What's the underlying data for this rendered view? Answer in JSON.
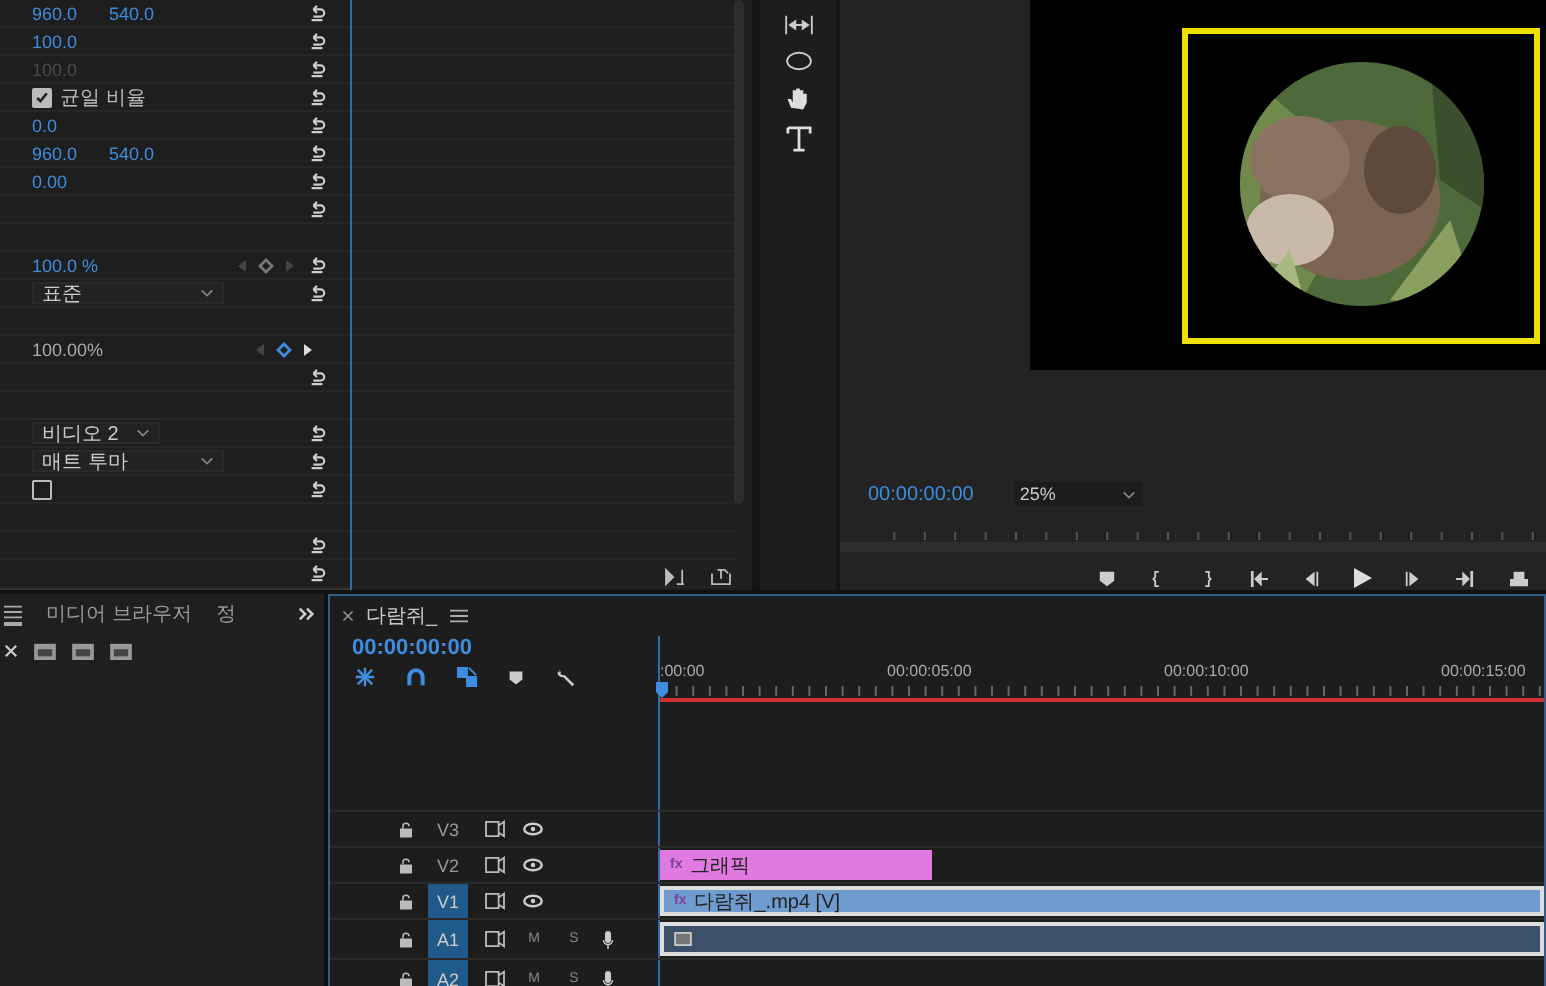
{
  "effect_controls": {
    "rows": [
      {
        "kind": "values",
        "values": [
          "960.0",
          "540.0"
        ],
        "dim": false,
        "reset": true
      },
      {
        "kind": "values",
        "values": [
          "100.0"
        ],
        "dim": false,
        "reset": true
      },
      {
        "kind": "values",
        "values": [
          "100.0"
        ],
        "dim": true,
        "reset": true
      },
      {
        "kind": "checkbox",
        "label": "균일 비율",
        "checked": true,
        "reset": true
      },
      {
        "kind": "values",
        "values": [
          "0.0"
        ],
        "dim": false,
        "reset": true
      },
      {
        "kind": "values",
        "values": [
          "960.0",
          "540.0"
        ],
        "dim": false,
        "reset": true
      },
      {
        "kind": "values",
        "values": [
          "0.00"
        ],
        "dim": false,
        "reset": true
      },
      {
        "kind": "empty",
        "reset": true
      },
      {
        "kind": "empty",
        "reset": false
      },
      {
        "kind": "keyed",
        "value": "100.0 %",
        "keyframe_active": false,
        "reset": true
      },
      {
        "kind": "dropdown",
        "value": "표준",
        "wide": true,
        "reset": true
      },
      {
        "kind": "empty",
        "reset": false
      },
      {
        "kind": "keyed",
        "value": "100.00%",
        "keyframe_active": true,
        "reset": false
      },
      {
        "kind": "empty",
        "reset": true
      },
      {
        "kind": "empty",
        "reset": false
      },
      {
        "kind": "dropdown",
        "value": "비디오 2",
        "wide": false,
        "reset": true
      },
      {
        "kind": "dropdown",
        "value": "매트 투마",
        "wide": true,
        "reset": true
      },
      {
        "kind": "checkbox",
        "checked": false,
        "reset": true
      },
      {
        "kind": "empty",
        "reset": false
      },
      {
        "kind": "empty",
        "reset": true
      },
      {
        "kind": "empty",
        "reset": true
      }
    ]
  },
  "program_monitor": {
    "timecode": "00:00:00:00",
    "zoom": "25%"
  },
  "project_panel": {
    "tabs": [
      {
        "label": "미디어 브라우저",
        "selected": false
      },
      {
        "label": "정",
        "selected": false
      }
    ]
  },
  "timeline": {
    "sequence_name": "다람쥐_",
    "timecode": "00:00:00:00",
    "ruler": [
      ":00:00",
      "00:00:05:00",
      "00:00:10:00",
      "00:00:15:00"
    ],
    "tracks": [
      {
        "name": "V3",
        "kind": "video",
        "selected": false
      },
      {
        "name": "V2",
        "kind": "video",
        "selected": false,
        "clip": {
          "kind": "graphic",
          "badge": "fx",
          "label": "그래픽"
        }
      },
      {
        "name": "V1",
        "kind": "video",
        "selected": true,
        "clip": {
          "kind": "video",
          "badge": "fx",
          "label": "다람쥐_.mp4 [V]"
        }
      },
      {
        "name": "A1",
        "kind": "audio",
        "selected": true,
        "mute": "M",
        "solo": "S",
        "clip": {
          "kind": "audio"
        }
      },
      {
        "name": "A2",
        "kind": "audio",
        "selected": true,
        "mute": "M",
        "solo": "S"
      }
    ]
  }
}
